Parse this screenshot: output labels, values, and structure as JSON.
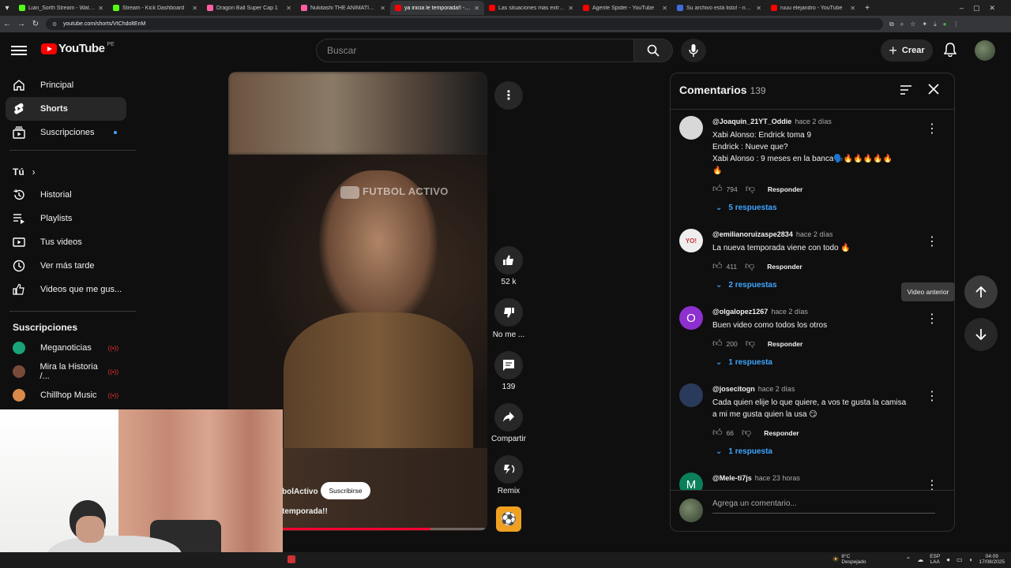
{
  "browser": {
    "tabs": [
      {
        "title": "Lian_Sorth Stream - Watch Liv",
        "color": "#53fc18"
      },
      {
        "title": "Stream - Kick Dashboard",
        "color": "#53fc18"
      },
      {
        "title": "Dragon Ball Super Cap 1",
        "color": "#ff5fa2"
      },
      {
        "title": "Nukitashi THE ANIMATION",
        "color": "#ff5fa2"
      },
      {
        "title": "ya inicia le temporada!! - Yo",
        "color": "#ff0000",
        "active": true
      },
      {
        "title": "Las situaciones más extrañas, n",
        "color": "#ff0000"
      },
      {
        "title": "Agente Spider - YouTube",
        "color": "#ff0000"
      },
      {
        "title": "Su archivo está listo! - noTube",
        "color": "#3b6ddc"
      },
      {
        "title": "ruuu elejandro - YouTube",
        "color": "#ff0000"
      }
    ],
    "url": "youtube.com/shorts/VtChdoltEnM",
    "new_tab": "+"
  },
  "header": {
    "logo": "YouTube",
    "country": "PE",
    "search_placeholder": "Buscar",
    "create_label": "Crear"
  },
  "sidebar": {
    "main": [
      {
        "label": "Principal",
        "icon": "home-icon"
      },
      {
        "label": "Shorts",
        "icon": "shorts-icon",
        "active": true
      },
      {
        "label": "Suscripciones",
        "icon": "subscriptions-icon",
        "dot": true
      }
    ],
    "you_title": "Tú",
    "you": [
      {
        "label": "Historial",
        "icon": "history-icon"
      },
      {
        "label": "Playlists",
        "icon": "playlists-icon"
      },
      {
        "label": "Tus videos",
        "icon": "your-videos-icon"
      },
      {
        "label": "Ver más tarde",
        "icon": "watch-later-icon"
      },
      {
        "label": "Videos que me gus...",
        "icon": "liked-icon"
      }
    ],
    "subs_title": "Suscripciones",
    "subs": [
      {
        "label": "Meganoticias",
        "color": "#1aa37a"
      },
      {
        "label": "Mira la Historia /...",
        "color": "#7a4b3a"
      },
      {
        "label": "Chillhop Music",
        "color": "#d98a4a"
      }
    ]
  },
  "video": {
    "watermark": "FUTBOL ACTIVO",
    "channel": "bolActivo",
    "subscribe_label": "Suscribirse",
    "title": "temporada!!",
    "progress": 0.78
  },
  "actions": {
    "likes": "52 k",
    "dislike": "No me ...",
    "comments": "139",
    "share": "Compartir",
    "remix": "Remix"
  },
  "comments": {
    "title": "Comentarios",
    "count": "139",
    "reply_label": "Responder",
    "input_placeholder": "Agrega un comentario...",
    "items": [
      {
        "author": "@Joaquín_21YT_Oddie",
        "time": "hace 2 días",
        "lines": [
          "Xabi Alonso: Endrick toma 9",
          "Endrick : Nueve que?",
          "Xabi Alonso : 9 meses en la banca🗣️🔥🔥🔥🔥🔥",
          "🔥"
        ],
        "likes": "794",
        "replies": "5 respuestas",
        "avatar_color": "#d8d8d8",
        "initial": ""
      },
      {
        "author": "@emilianoruizaspe2834",
        "time": "hace 2 días",
        "lines": [
          "La nueva temporada viene con todo 🔥"
        ],
        "likes": "411",
        "replies": "2 respuestas",
        "avatar_color": "#eeeeee",
        "initial": ""
      },
      {
        "author": "@olgalopez1267",
        "time": "hace 2 días",
        "lines": [
          "Buen video como todos los otros"
        ],
        "likes": "200",
        "replies": "1 respuesta",
        "avatar_color": "#8e2fd0",
        "initial": "O"
      },
      {
        "author": "@josecitogn",
        "time": "hace 2 días",
        "lines": [
          "Cada quien elije lo que quiere, a vos te gusta la camisa",
          "a mi me gusta quien la usa 😏"
        ],
        "likes": "66",
        "replies": "1 respuesta",
        "avatar_color": "#2a3a5a",
        "initial": ""
      },
      {
        "author": "@Mele-ti7js",
        "time": "hace 23 horas",
        "lines": [],
        "likes": "",
        "replies": "",
        "avatar_color": "#0a7f5a",
        "initial": "M"
      }
    ]
  },
  "nav": {
    "tooltip": "Video anterior"
  },
  "taskbar": {
    "weather_temp": "8°C",
    "weather_desc": "Despejado",
    "lang_top": "ESP",
    "lang_bottom": "LAA",
    "time": "04:09",
    "date": "17/08/2025"
  }
}
